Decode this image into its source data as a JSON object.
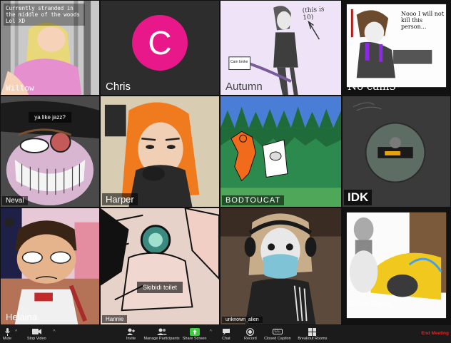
{
  "colors": {
    "chris_avatar_bg": "#e8178a",
    "share_screen_green": "#3ec93e",
    "end_meeting_red": "#e02424"
  },
  "tiles": [
    {
      "name": "Willow",
      "overlay_text": "Currently stranded in the middle of the woods Lol XD"
    },
    {
      "name": "Chris",
      "avatar_letter": "C"
    },
    {
      "name": "Autumn",
      "art_text": "(this is 10)",
      "sign_text": "Cam broke"
    },
    {
      "name": "No cam3",
      "art_text": "Nooo I will not kill this person..."
    },
    {
      "name": "Neval",
      "overlay_text": "ya like jazz?"
    },
    {
      "name": "Harper"
    },
    {
      "name": "BODTOUCAT"
    },
    {
      "name": "IDK"
    },
    {
      "name": "Helaina"
    },
    {
      "name": "Hannie",
      "overlay_text": "Skibidi toilet"
    },
    {
      "name": "unknown_alien"
    },
    {
      "name": "Skibidi Sigma"
    }
  ],
  "toolbar": {
    "mute": "Mute",
    "stop_video": "Stop Video",
    "invite": "Invite",
    "manage_participants": "Manage Participants",
    "share_screen": "Share Screen",
    "chat": "Chat",
    "record": "Record",
    "closed_caption": "Closed Caption",
    "breakout_rooms": "Breakout Rooms",
    "end_meeting": "End Meeting",
    "caret": "^",
    "cc_icon": "CC"
  },
  "icons": [
    "microphone-icon",
    "video-camera-icon",
    "invite-icon",
    "participants-icon",
    "share-screen-icon",
    "chat-icon",
    "record-icon",
    "closed-caption-icon",
    "breakout-rooms-icon"
  ]
}
